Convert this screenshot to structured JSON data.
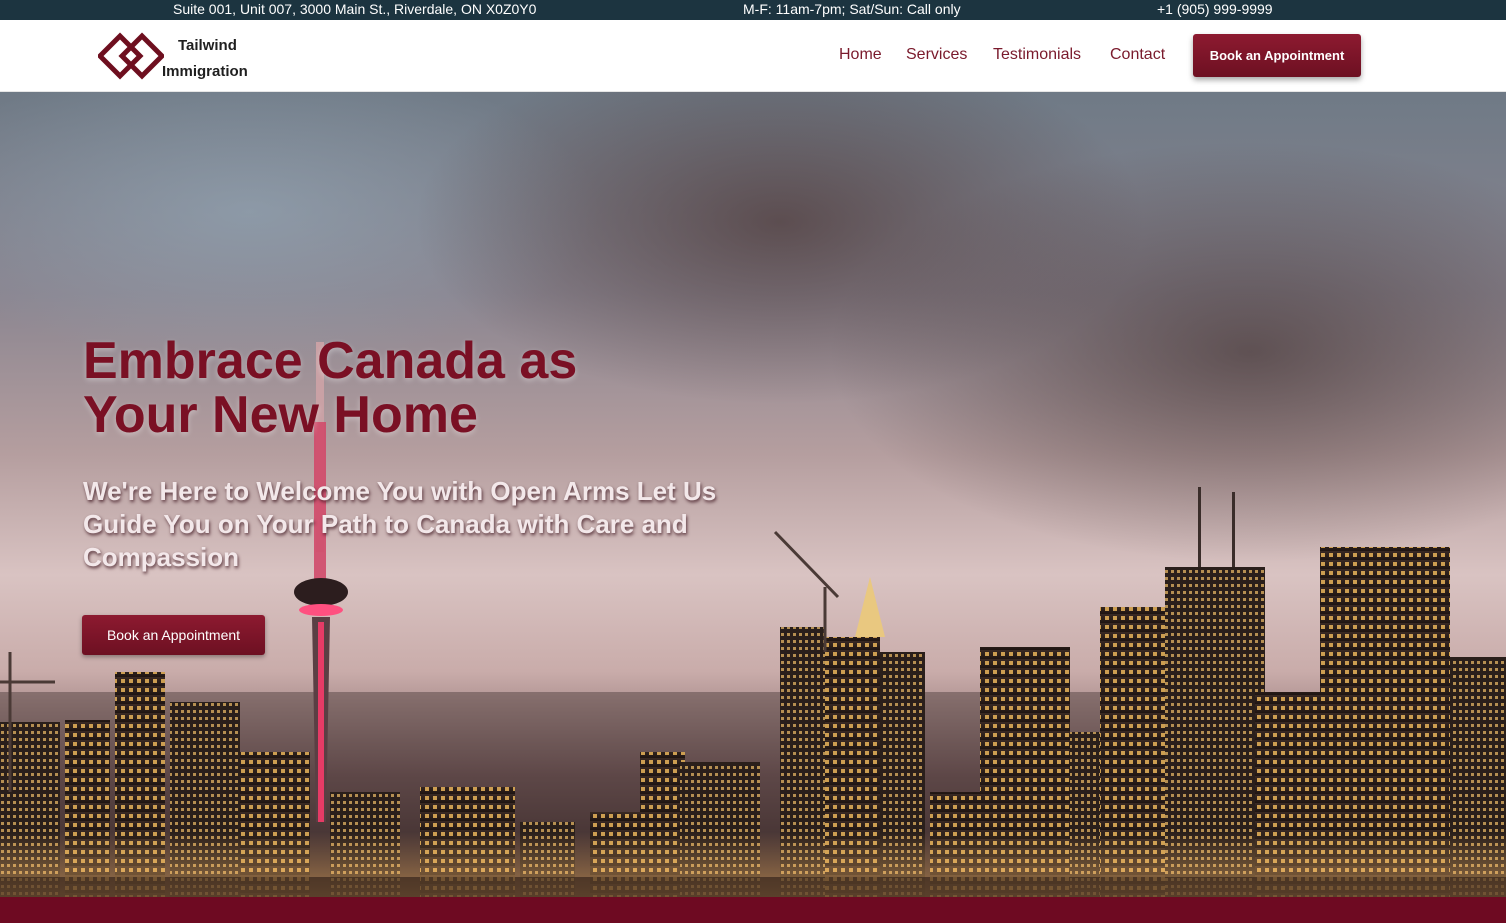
{
  "topbar": {
    "address": "Suite 001, Unit 007, 3000 Main St., Riverdale, ON X0Z0Y0",
    "hours": "M-F: 11am-7pm; Sat/Sun: Call only",
    "phone": "+1 (905) 999-9999"
  },
  "header": {
    "logo_line1": "Tailwind",
    "logo_line2": "Immigration",
    "logo_icon": "interlocked-diamonds-icon",
    "nav": [
      "Home",
      "Services",
      "Testimonials",
      "Contact"
    ],
    "cta_label": "Book an Appointment"
  },
  "hero": {
    "title": "Embrace Canada as Your New Home",
    "subtitle": "We're Here to Welcome You with Open Arms Let Us Guide You on Your Path to Canada with Care and Compassion",
    "cta_label": "Book an Appointment"
  },
  "colors": {
    "brand": "#7a1024",
    "topbar_bg": "#1c3440",
    "footer_strip": "#6e0a22"
  }
}
